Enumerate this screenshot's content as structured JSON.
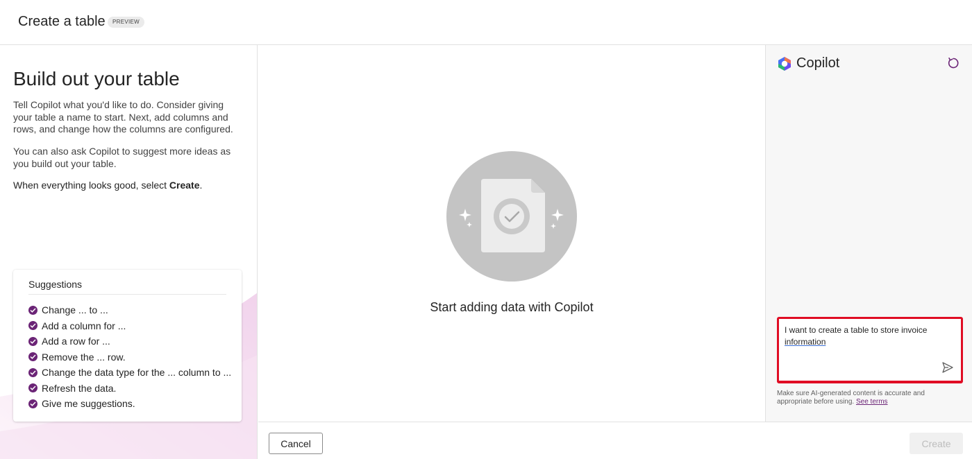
{
  "header": {
    "title": "Create a table",
    "badge": "PREVIEW"
  },
  "left": {
    "heading": "Build out your table",
    "paragraph1": "Tell Copilot what you'd like to do. Consider giving your table a name to start. Next, add columns and rows, and change how the columns are configured.",
    "paragraph2": "You can also ask Copilot to suggest more ideas as you build out your table.",
    "paragraph3_prefix": "When everything looks good, select ",
    "paragraph3_bold": "Create",
    "paragraph3_suffix": ".",
    "suggestions": {
      "title": "Suggestions",
      "items": [
        "Change ... to ...",
        "Add a column for ...",
        "Add a row for ...",
        "Remove the ... row.",
        "Change the data type for the ... column to ...",
        "Refresh the data.",
        "Give me suggestions."
      ]
    }
  },
  "center": {
    "empty_state_text": "Start adding data with Copilot"
  },
  "copilot": {
    "title": "Copilot",
    "input_text_part1": "I want to create a table to store invoice ",
    "input_text_part2": "information",
    "disclaimer_text": "Make sure AI-generated content is accurate and appropriate before using.",
    "terms_link": "See terms"
  },
  "footer": {
    "cancel_label": "Cancel",
    "create_label": "Create"
  },
  "colors": {
    "accent": "#6b2476",
    "highlight_border": "#e00d24"
  }
}
